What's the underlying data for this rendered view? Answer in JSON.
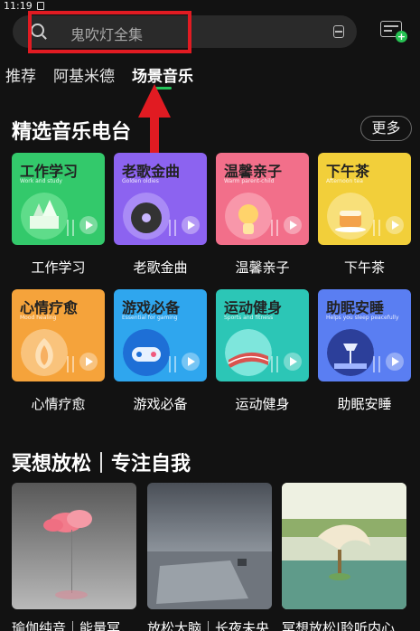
{
  "status": {
    "time": "11:19"
  },
  "search": {
    "placeholder": "鬼吹灯全集"
  },
  "tabs": [
    "推荐",
    "阿基米德",
    "场景音乐"
  ],
  "section1": {
    "title": "精选音乐电台",
    "more": "更多"
  },
  "cards": [
    {
      "title": "工作学习",
      "sub": "Work and study",
      "label": "工作学习",
      "color": "#33c96b"
    },
    {
      "title": "老歌金曲",
      "sub": "Golden oldies",
      "label": "老歌金曲",
      "color": "#8c63f0"
    },
    {
      "title": "温馨亲子",
      "sub": "Warm parent-child",
      "label": "温馨亲子",
      "color": "#f26f8a"
    },
    {
      "title": "下午茶",
      "sub": "Afternoon tea",
      "label": "下午茶",
      "color": "#f2cf3a"
    },
    {
      "title": "心情疗愈",
      "sub": "Mood healing",
      "label": "心情疗愈",
      "color": "#f5a33b"
    },
    {
      "title": "游戏必备",
      "sub": "Essential for gaming",
      "label": "游戏必备",
      "color": "#2fa6ee"
    },
    {
      "title": "运动健身",
      "sub": "Sports and fitness",
      "label": "运动健身",
      "color": "#2cc6b6"
    },
    {
      "title": "助眠安睡",
      "sub": "Helps you sleep peacefully",
      "label": "助眠安睡",
      "color": "#5a7ef2"
    }
  ],
  "section2": {
    "title": "冥想放松｜专注自我"
  },
  "playlists": [
    {
      "title": "瑜伽纯音｜能量冥"
    },
    {
      "title": "放松大脑｜长夜未央"
    },
    {
      "title": "冥想放松|聆听内心"
    }
  ]
}
